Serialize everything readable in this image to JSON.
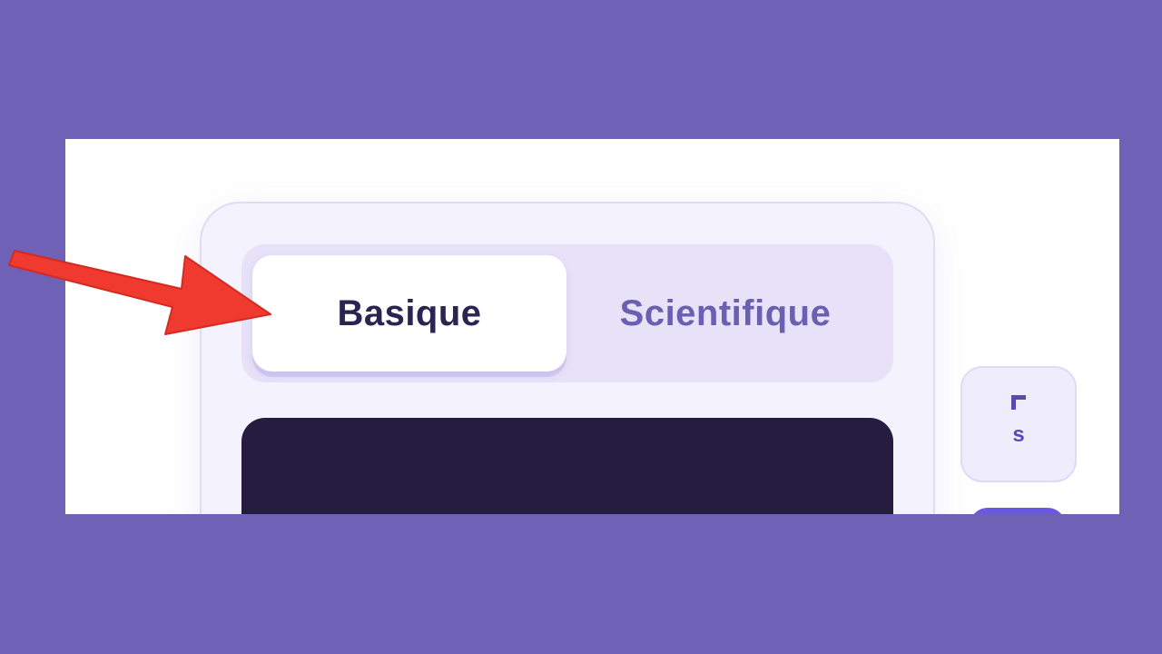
{
  "calculator": {
    "tabs": [
      {
        "label": "Basique",
        "active": true
      },
      {
        "label": "Scientifique",
        "active": false
      }
    ],
    "side_key": {
      "label": "s",
      "icon": "corner-bracket-icon"
    }
  },
  "colors": {
    "background": "#6f62b6",
    "active_tab_text": "#2b2451",
    "inactive_tab_text": "#6a5fb0",
    "display": "#251d40",
    "arrow": "#f03a30"
  },
  "annotation": {
    "icon": "red-arrow-icon"
  }
}
